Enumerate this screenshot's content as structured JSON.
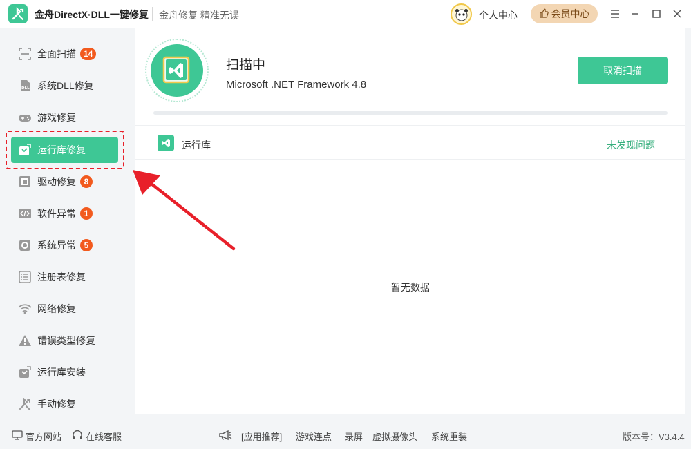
{
  "app": {
    "title": "金舟DirectX·DLL一键修复",
    "slogan": "金舟修复 精准无误",
    "personal_center": "个人中心",
    "vip_center": "会员中心"
  },
  "sidebar": {
    "items": [
      {
        "label": "全面扫描",
        "badge": "14",
        "icon": "scan-icon"
      },
      {
        "label": "系统DLL修复",
        "badge": "",
        "icon": "dll-icon"
      },
      {
        "label": "游戏修复",
        "badge": "",
        "icon": "gamepad-icon"
      },
      {
        "label": "运行库修复",
        "badge": "",
        "icon": "runtime-icon",
        "active": true
      },
      {
        "label": "驱动修复",
        "badge": "8",
        "icon": "driver-icon"
      },
      {
        "label": "软件异常",
        "badge": "1",
        "icon": "code-icon"
      },
      {
        "label": "系统异常",
        "badge": "5",
        "icon": "gear-icon"
      },
      {
        "label": "注册表修复",
        "badge": "",
        "icon": "list-icon"
      },
      {
        "label": "网络修复",
        "badge": "",
        "icon": "wifi-icon"
      },
      {
        "label": "错误类型修复",
        "badge": "",
        "icon": "warning-icon"
      },
      {
        "label": "运行库安装",
        "badge": "",
        "icon": "install-icon"
      },
      {
        "label": "手动修复",
        "badge": "",
        "icon": "wrench-icon"
      }
    ]
  },
  "scan": {
    "title": "扫描中",
    "subtitle": "Microsoft .NET Framework 4.8",
    "cancel_label": "取消扫描",
    "progress": 0
  },
  "result_row": {
    "label": "运行库",
    "status": "未发现问题"
  },
  "empty_text": "暂无数据",
  "footer": {
    "website": "官方网站",
    "support": "在线客服",
    "recommend": "[应用推荐]",
    "links": [
      "游戏连点",
      "录屏",
      "虚拟摄像头",
      "系统重装"
    ],
    "version": "版本号：V3.4.4"
  },
  "colors": {
    "accent": "#3ec795",
    "badge": "#f25a1e",
    "annotation": "#e8202a",
    "vip_bg": "#f3d6b3"
  }
}
